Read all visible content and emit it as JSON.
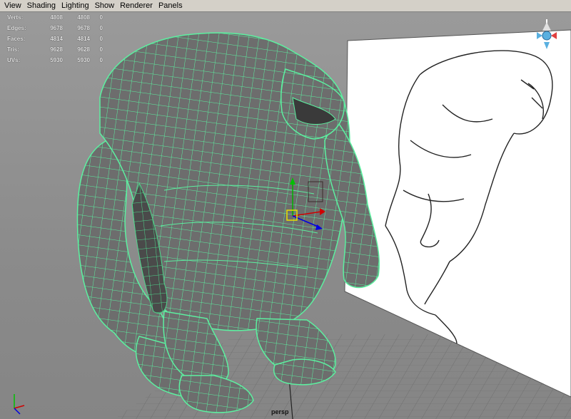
{
  "menubar": {
    "items": [
      "View",
      "Shading",
      "Lighting",
      "Show",
      "Renderer",
      "Panels"
    ]
  },
  "hud": {
    "rows": [
      {
        "label": "Verts:",
        "v1": "4808",
        "v2": "4808",
        "v3": "0"
      },
      {
        "label": "Edges:",
        "v1": "9678",
        "v2": "9678",
        "v3": "0"
      },
      {
        "label": "Faces:",
        "v1": "4814",
        "v2": "4814",
        "v3": "0"
      },
      {
        "label": "Tris:",
        "v1": "9628",
        "v2": "9628",
        "v3": "0"
      },
      {
        "label": "UVs:",
        "v1": "5930",
        "v2": "5930",
        "v3": "0"
      }
    ]
  },
  "viewport": {
    "camera": "persp"
  },
  "colors": {
    "wire": "#5cf0a0",
    "mesh": "#6e6e6e",
    "menubar": "#d4d0c8",
    "background": "#8f8f8f"
  },
  "icons": {
    "view_cube": "view-cube-icon",
    "axis": "axis-indicator-icon",
    "manipulator": "move-manipulator-icon"
  }
}
